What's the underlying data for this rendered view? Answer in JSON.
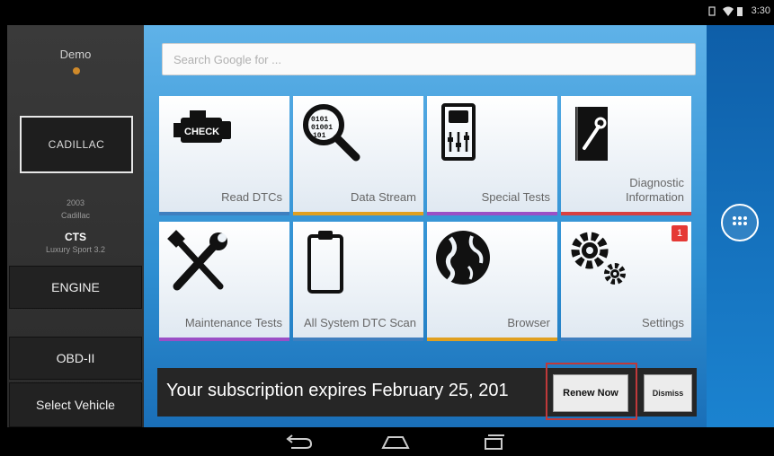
{
  "status_bar": {
    "time": "3:30"
  },
  "sidebar": {
    "demo_label": "Demo",
    "brand": "CADILLAC",
    "year": "2003",
    "make": "Cadillac",
    "model": "CTS",
    "trim": "Luxury Sport 3.2",
    "engine_button": "ENGINE",
    "obd_button": "OBD-II",
    "select_vehicle_button": "Select Vehicle"
  },
  "search": {
    "placeholder": "Search Google for ..."
  },
  "tiles": [
    {
      "label": "Read DTCs",
      "icon": "check-engine-icon",
      "accent": "#3f7fbf"
    },
    {
      "label": "Data Stream",
      "icon": "magnifier-binary-icon",
      "accent": "#e0a020"
    },
    {
      "label": "Special Tests",
      "icon": "car-controls-icon",
      "accent": "#9b4fc6"
    },
    {
      "label": "Diagnostic Information",
      "icon": "manual-wrench-icon",
      "accent": "#d84040"
    },
    {
      "label": "Maintenance Tests",
      "icon": "wrench-screwdriver-icon",
      "accent": "#9b4fc6"
    },
    {
      "label": "All System DTC Scan",
      "icon": "clipboard-icon",
      "accent": "#3f7fbf"
    },
    {
      "label": "Browser",
      "icon": "globe-icon",
      "accent": "#e0a020"
    },
    {
      "label": "Settings",
      "icon": "gears-icon",
      "accent": "#3f7fbf",
      "badge": "1"
    }
  ],
  "subscription": {
    "message": "Your subscription expires February 25, 201",
    "renew_label": "Renew Now",
    "dismiss_label": "Dismiss"
  },
  "colors": {
    "highlight": "#c0393a",
    "badge": "#e53935"
  }
}
